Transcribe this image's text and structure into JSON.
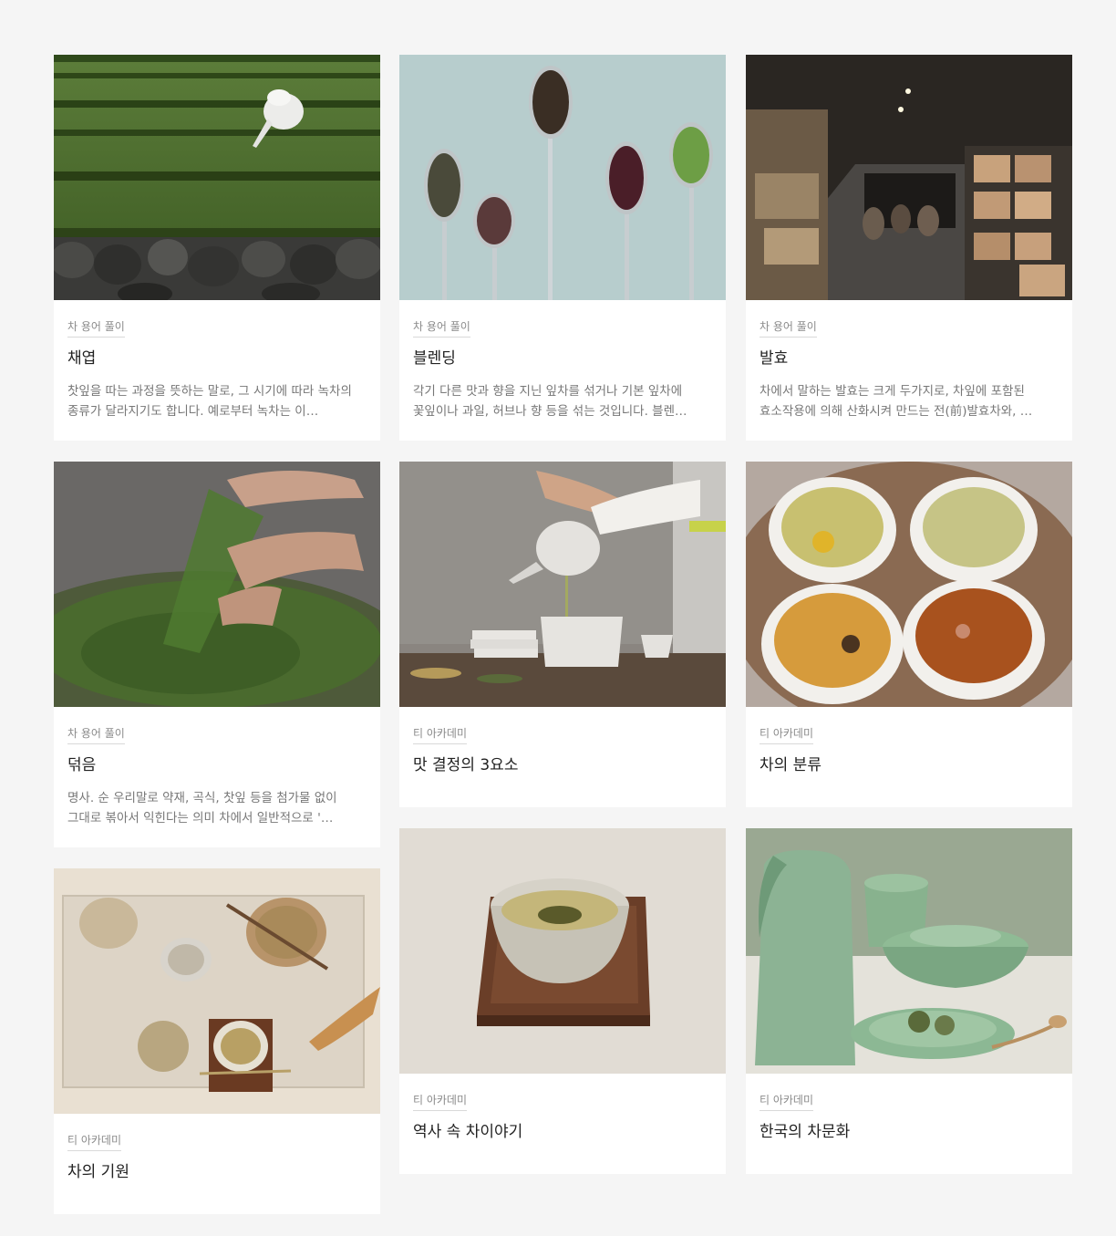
{
  "cards": [
    {
      "category": "차 용어 풀이",
      "title": "채엽",
      "desc": "찻잎을 따는 과정을 뜻하는 말로, 그 시기에 따라 녹차의 종류가 달라지기도 합니다. 예로부터 녹차는 이…",
      "image": "tea-plantation-photo"
    },
    {
      "category": "차 용어 풀이",
      "title": "블렌딩",
      "desc": "각기 다른 맛과 향을 지닌 잎차를 섞거나 기본 잎차에 꽃잎이나 과일, 허브나 향 등을 섞는 것입니다. 블렌…",
      "image": "tea-spoons-photo"
    },
    {
      "category": "차 용어 풀이",
      "title": "발효",
      "desc": "차에서 말하는 발효는 크게 두가지로, 차잎에 포함된 효소작용에 의해 산화시켜 만드는 전(前)발효차와, …",
      "image": "tea-storage-room-photo"
    },
    {
      "category": "차 용어 풀이",
      "title": "덖음",
      "desc": "명사. 순 우리말로 약재, 곡식, 찻잎 등을 첨가물 없이 그대로 볶아서 익힌다는 의미 차에서 일반적으로 '…",
      "image": "roasting-tea-leaves-photo"
    },
    {
      "category": "티 아카데미",
      "title": "맛 결정의 3요소",
      "image": "pouring-tea-photo"
    },
    {
      "category": "티 아카데미",
      "title": "차의 분류",
      "image": "four-tea-cups-photo"
    },
    {
      "category": "티 아카데미",
      "title": "차의 기원",
      "image": "tea-set-overhead-photo"
    },
    {
      "category": "티 아카데미",
      "title": "역사 속 차이야기",
      "image": "tea-bowl-photo"
    },
    {
      "category": "티 아카데미",
      "title": "한국의 차문화",
      "image": "celadon-pottery-photo"
    }
  ]
}
